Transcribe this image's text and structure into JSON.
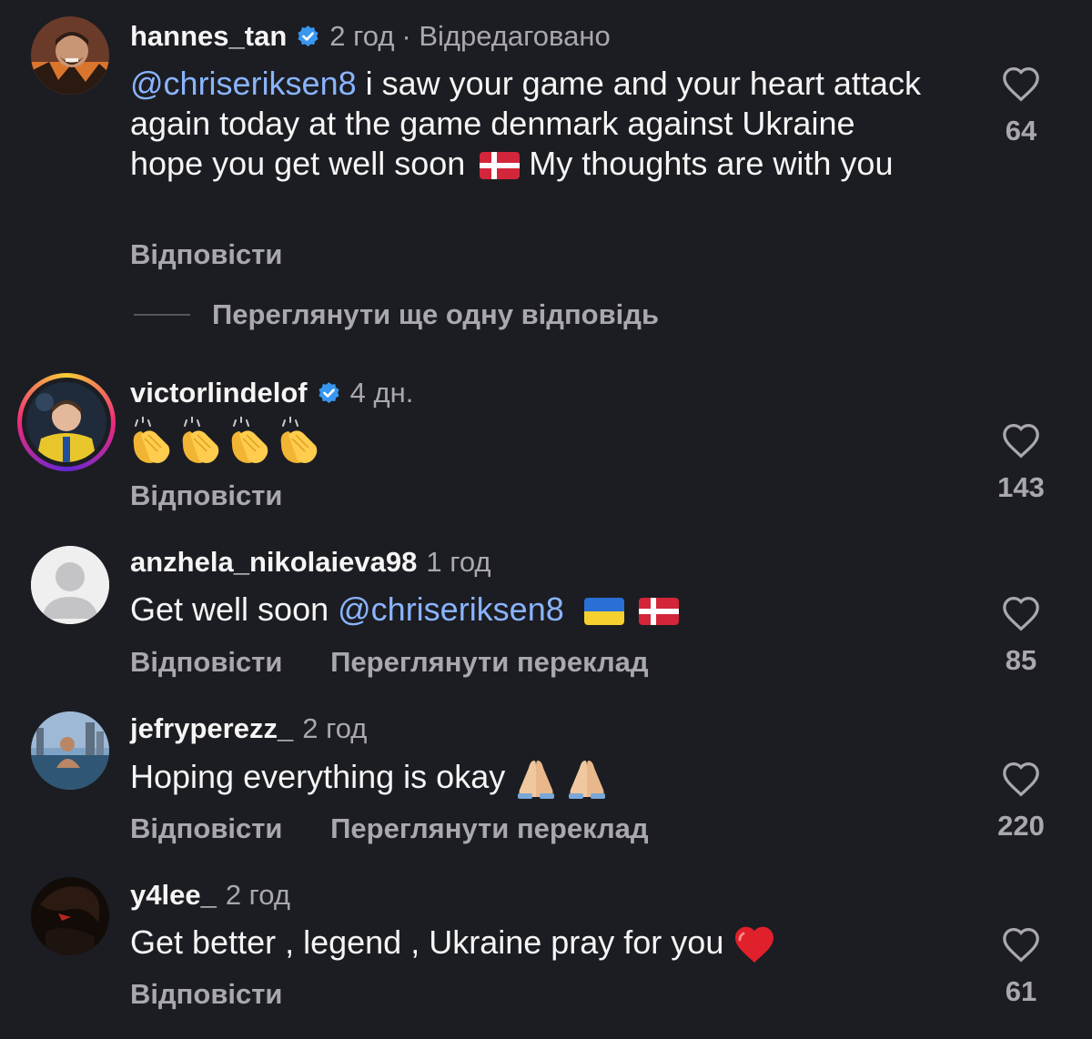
{
  "comments": [
    {
      "username": "hannes_tan",
      "time": "2 год",
      "edited": "· Відредаговано",
      "mention": "@chriseriksen8",
      "text": " i saw your game and your heart attack again today  at the game denmark against Ukraine hope you get well soon ",
      "text_after": " My thoughts are with you",
      "reply": "Відповісти",
      "likes": "64",
      "view_more": "Переглянути ще одну відповідь",
      "icon": "verified-badge-icon"
    },
    {
      "username": "victorlindelof",
      "time": "4 дн.",
      "reply": "Відповісти",
      "likes": "143",
      "icon": "clapping-hands-icon"
    },
    {
      "username": "anzhela_nikolaieva98",
      "time": "1 год",
      "text": "Get well soon ",
      "mention": "@chriseriksen8",
      "reply": "Відповісти",
      "translate": "Переглянути переклад",
      "likes": "85"
    },
    {
      "username": "jefryperezz_",
      "time": "2 год",
      "text": "Hoping everything is okay ",
      "reply": "Відповісти",
      "translate": "Переглянути переклад",
      "likes": "220"
    },
    {
      "username": "y4lee_",
      "time": "2 год",
      "text": "Get better , legend , Ukraine pray for you ",
      "reply": "Відповісти",
      "likes": "61"
    }
  ],
  "colors": {
    "background": "#1c1d22",
    "mention": "#8ab4ff",
    "secondary_text": "#a8a8ad",
    "verified": "#3897f0"
  }
}
